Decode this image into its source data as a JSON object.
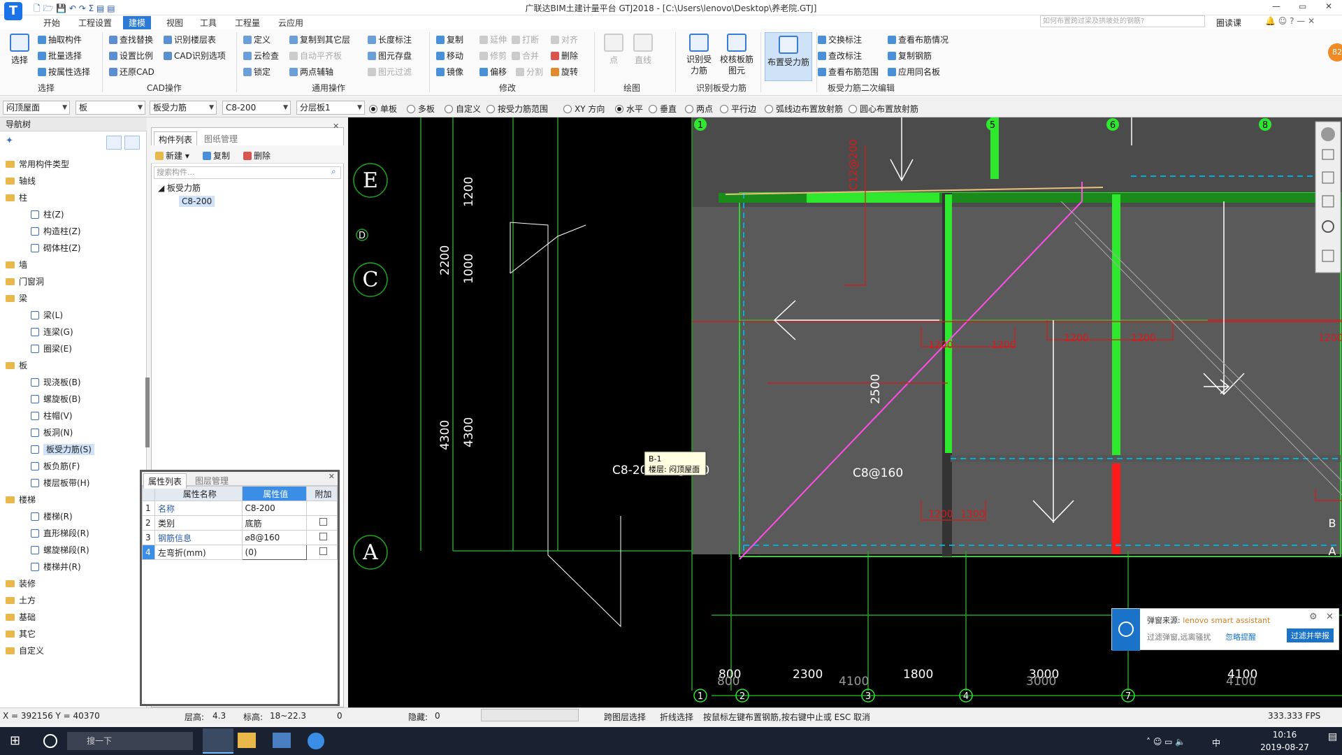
{
  "window": {
    "title": "广联达BIM土建计量平台 GTJ2018 - [C:\\Users\\lenovo\\Desktop\\养老院.GTJ]",
    "app_icon": "T",
    "search_placeholder": "如何布置跨过梁及拱坡处的钢筋?",
    "help_label": "圈读课",
    "controls": [
      "—",
      "▭",
      "✕"
    ]
  },
  "menus": [
    "开始",
    "工程设置",
    "建模",
    "视图",
    "工具",
    "工程量",
    "云应用"
  ],
  "ribbon": {
    "select_big": "选择",
    "select": [
      "抽取构件",
      "批量选择",
      "按属性选择"
    ],
    "select_group": "选择",
    "cad": [
      "查找替换",
      "识别楼层表",
      "设置比例",
      "CAD识别选项",
      "还原CAD"
    ],
    "cad_group": "CAD操作",
    "common": [
      "定义",
      "复制到其它层",
      "长度标注",
      "云检查",
      "自动平齐板",
      "图元存盘",
      "锁定",
      "两点辅轴",
      "图元过滤"
    ],
    "common_group": "通用操作",
    "modify": [
      "复制",
      "延伸",
      "打断",
      "对齐",
      "移动",
      "修剪",
      "合并",
      "删除",
      "镜像",
      "偏移",
      "分割",
      "旋转"
    ],
    "modify_group": "修改",
    "draw": [
      "点",
      "直线"
    ],
    "draw_group": "绘图",
    "recog": [
      "识别受力筋",
      "校核板筋图元"
    ],
    "recog_group": "识别板受力筋",
    "place": "布置受力筋",
    "edit2": [
      "交换标注",
      "查看布筋情况",
      "查改标注",
      "复制钢筋",
      "查看布筋范围",
      "应用同名板"
    ],
    "edit2_group": "板受力筋二次编辑"
  },
  "toolbar": {
    "combos": [
      "闷顶屋面",
      "板",
      "板受力筋",
      "C8-200",
      "分层板1"
    ],
    "radios": [
      "单板",
      "多板",
      "自定义",
      "按受力筋范围",
      "XY 方向",
      "水平",
      "垂直",
      "两点",
      "平行边",
      "弧线边布置放射筋",
      "圆心布置放射筋"
    ]
  },
  "nav": {
    "title": "导航树",
    "items": [
      {
        "t": "常用构件类型",
        "k": "folder"
      },
      {
        "t": "轴线",
        "k": "folder"
      },
      {
        "t": "柱",
        "k": "folder"
      },
      {
        "t": "柱(Z)",
        "k": "leaf"
      },
      {
        "t": "构造柱(Z)",
        "k": "leaf"
      },
      {
        "t": "砌体柱(Z)",
        "k": "leaf"
      },
      {
        "t": "墙",
        "k": "folder"
      },
      {
        "t": "门窗洞",
        "k": "folder"
      },
      {
        "t": "梁",
        "k": "folder"
      },
      {
        "t": "梁(L)",
        "k": "leaf"
      },
      {
        "t": "连梁(G)",
        "k": "leaf"
      },
      {
        "t": "圈梁(E)",
        "k": "leaf"
      },
      {
        "t": "板",
        "k": "folder"
      },
      {
        "t": "现浇板(B)",
        "k": "leaf"
      },
      {
        "t": "螺旋板(B)",
        "k": "leaf"
      },
      {
        "t": "柱帽(V)",
        "k": "leaf"
      },
      {
        "t": "板洞(N)",
        "k": "leaf"
      },
      {
        "t": "板受力筋(S)",
        "k": "leaf"
      },
      {
        "t": "板负筋(F)",
        "k": "leaf"
      },
      {
        "t": "楼层板带(H)",
        "k": "leaf"
      },
      {
        "t": "楼梯",
        "k": "folder"
      },
      {
        "t": "楼梯(R)",
        "k": "leaf"
      },
      {
        "t": "直形梯段(R)",
        "k": "leaf"
      },
      {
        "t": "螺旋梯段(R)",
        "k": "leaf"
      },
      {
        "t": "楼梯井(R)",
        "k": "leaf"
      },
      {
        "t": "装修",
        "k": "folder"
      },
      {
        "t": "土方",
        "k": "folder"
      },
      {
        "t": "基础",
        "k": "folder"
      },
      {
        "t": "其它",
        "k": "folder"
      },
      {
        "t": "自定义",
        "k": "folder"
      }
    ]
  },
  "complist": {
    "tabs": [
      "构件列表",
      "图纸管理"
    ],
    "buttons": [
      "新建",
      "复制",
      "删除"
    ],
    "search": "搜索构件...",
    "group": "板受力筋",
    "item": "C8-200"
  },
  "props": {
    "tabs": [
      "属性列表",
      "图层管理"
    ],
    "headers": [
      "属性名称",
      "属性值",
      "附加"
    ],
    "rows": [
      [
        "1",
        "名称",
        "C8-200"
      ],
      [
        "2",
        "类别",
        "底筋"
      ],
      [
        "3",
        "钢筋信息",
        "⌀8@160"
      ],
      [
        "4",
        "左弯折(mm)",
        "(0)"
      ]
    ]
  },
  "cad": {
    "axis_top": [
      "1",
      "5",
      "6",
      "8"
    ],
    "axis_left": [
      "E",
      "D",
      "C",
      "A"
    ],
    "axis_bottom": [
      "1",
      "2",
      "3",
      "4",
      "7"
    ],
    "axis_right": [
      "B",
      "A"
    ],
    "dims_left": [
      "1200",
      "1000",
      "4300",
      "2200",
      "4300"
    ],
    "dims_bottom": [
      "800",
      "2300",
      "1800",
      "3000",
      "4100"
    ],
    "dims_bottom2": [
      "800",
      "4100",
      "3000",
      "4100"
    ],
    "dims_mid": [
      "2500",
      "1200",
      "1200",
      "1200",
      "1200",
      "1200",
      "1200",
      "1300"
    ],
    "rebar_label": "C8-200:C8@160",
    "rebar_label2": "C8@160",
    "vert_label": "C12@200",
    "tooltip": {
      "line1": "B-1",
      "line2": "楼层: 闷顶屋面"
    }
  },
  "popup": {
    "source": "弹窗来源:",
    "app": "lenovo smart assistant",
    "text": "过滤弹窗,远离骚扰",
    "ignore": "忽略提醒",
    "button": "过滤并举报"
  },
  "status": {
    "coords": "X = 392156 Y = 40370",
    "floor_h": "层高:",
    "floor_v": "4.3",
    "elev": "标高:",
    "elev_v": "18~22.3",
    "zero": "0",
    "hidden": "隐藏:",
    "hidden_v": "0",
    "b1": "跨图层选择",
    "b2": "折线选择",
    "hint": "按鼠标左键布置钢筋,按右键中止或 ESC 取消",
    "fps": "333.333 FPS"
  },
  "taskbar": {
    "search": "搜一下",
    "time": "10:16",
    "date": "2019-08-27",
    "ime": "中"
  },
  "side_badge": "82"
}
